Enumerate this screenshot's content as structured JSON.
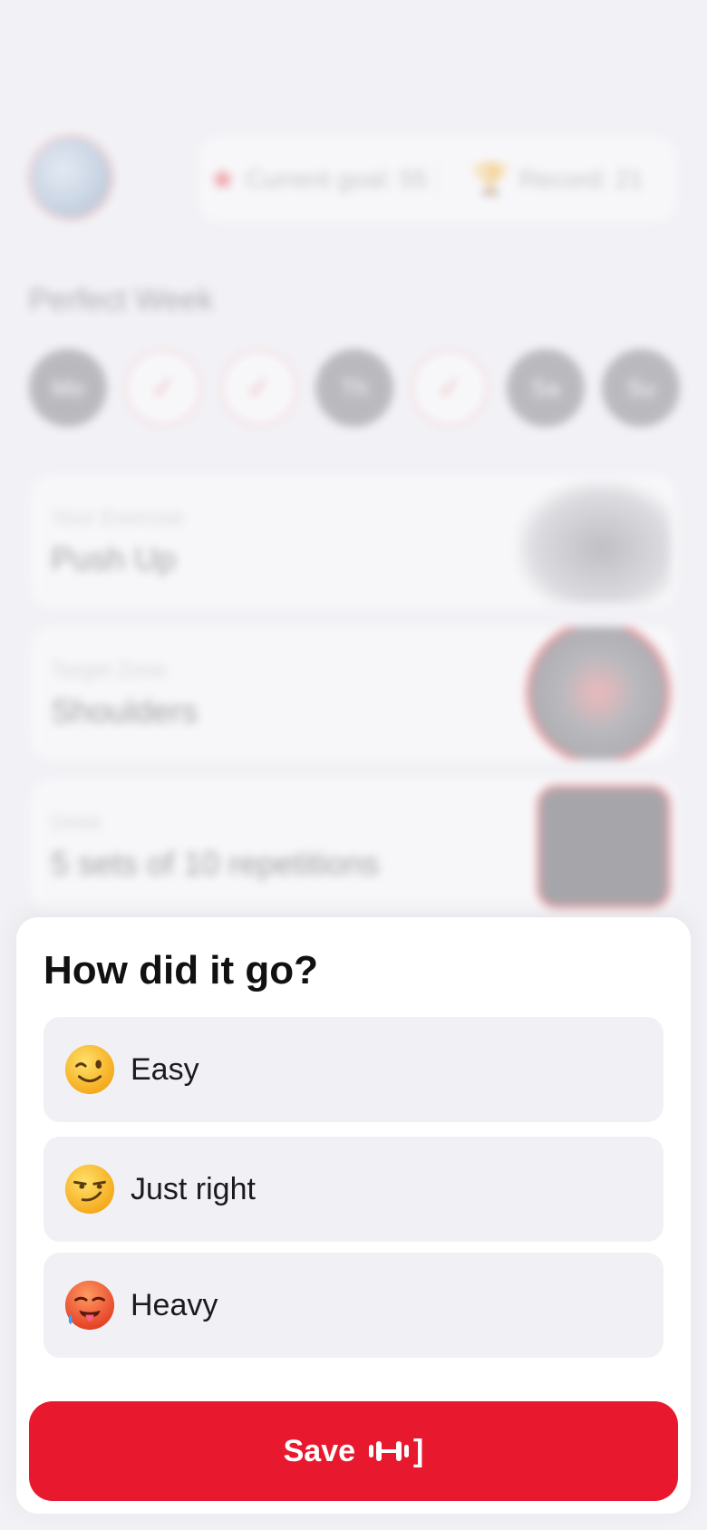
{
  "background": {
    "stats": {
      "current_goal": "Current goal: 55",
      "record": "Record: 21"
    },
    "week": {
      "title": "Perfect Week",
      "days": [
        {
          "label": "Mo",
          "done": false
        },
        {
          "label": "✓",
          "done": true
        },
        {
          "label": "✓",
          "done": true
        },
        {
          "label": "Th",
          "done": false
        },
        {
          "label": "✓",
          "done": true
        },
        {
          "label": "Sa",
          "done": false
        },
        {
          "label": "Su",
          "done": false
        }
      ]
    },
    "cards": {
      "exercise": {
        "label": "Your Exercise",
        "value": "Push Up"
      },
      "zone": {
        "label": "Target Zone",
        "value": "Shoulders"
      },
      "dose": {
        "label": "Dose",
        "value": "5 sets of 10 repetitions"
      }
    }
  },
  "sheet": {
    "title": "How did it go?",
    "options": [
      {
        "label": "Easy",
        "icon": "winking-face-icon"
      },
      {
        "label": "Just right",
        "icon": "smirking-face-icon"
      },
      {
        "label": "Heavy",
        "icon": "hot-face-icon"
      }
    ],
    "save_label": "Save",
    "save_suffix": "]"
  },
  "colors": {
    "accent": "#e8192e",
    "option_bg": "#f1f1f5",
    "page_bg": "#f2f2f6"
  }
}
